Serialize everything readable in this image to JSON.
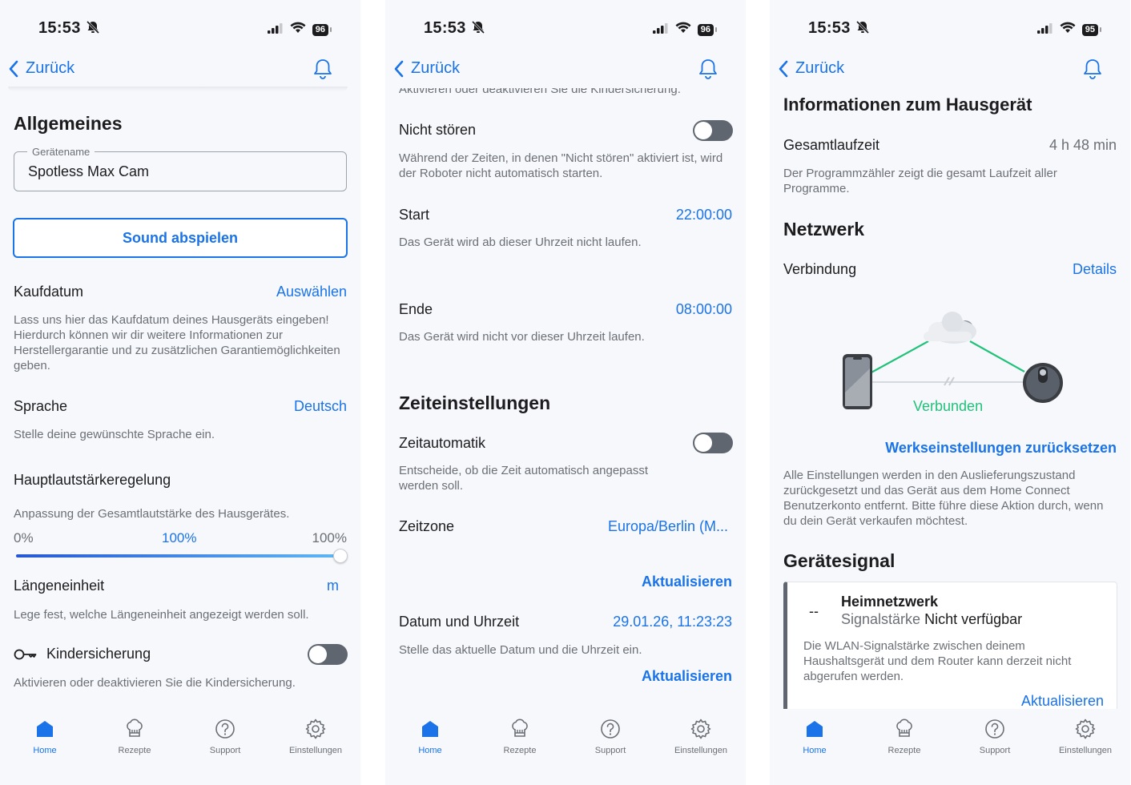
{
  "status": {
    "time": "15:53",
    "battery_1": "96",
    "battery_2": "96",
    "battery_3": "95"
  },
  "nav": {
    "back_label": "Zurück"
  },
  "screen1": {
    "section_title": "Allgemeines",
    "device_name_label": "Gerätename",
    "device_name_value": "Spotless Max Cam",
    "play_sound_button": "Sound abspielen",
    "purchase_date": {
      "label": "Kaufdatum",
      "value": "Auswählen",
      "desc": "Lass uns hier das Kaufdatum deines Hausgeräts eingeben! Hierdurch können wir dir weitere Informationen zur Herstellergarantie und zu zusätzlichen Garantiemöglichkeiten geben."
    },
    "language": {
      "label": "Sprache",
      "value": "Deutsch",
      "desc": "Stelle deine gewünschte Sprache ein."
    },
    "volume": {
      "label": "Hauptlautstärkeregelung",
      "desc": "Anpassung der Gesamtlautstärke des Hausgerätes.",
      "min_label": "0%",
      "current_label": "100%",
      "max_label": "100%",
      "level": 1.0
    },
    "length_unit": {
      "label": "Längeneinheit",
      "value": "m",
      "desc": "Lege fest, welche Längeneinheit angezeigt werden soll."
    },
    "child_lock": {
      "label": "Kindersicherung",
      "desc": "Aktivieren oder deaktivieren Sie die Kindersicherung.",
      "enabled": false
    }
  },
  "screen2": {
    "top_cut_text": "Aktivieren oder deaktivieren Sie die Kindersicherung.",
    "dnd": {
      "label": "Nicht stören",
      "desc": "Während der Zeiten, in denen \"Nicht stören\" aktiviert ist, wird der Roboter nicht automatisch starten.",
      "enabled": false
    },
    "start": {
      "label": "Start",
      "value": "22:00:00",
      "desc": "Das Gerät wird ab dieser Uhrzeit nicht laufen."
    },
    "end": {
      "label": "Ende",
      "value": "08:00:00",
      "desc": "Das Gerät wird nicht vor dieser Uhrzeit laufen."
    },
    "time_settings_title": "Zeiteinstellungen",
    "auto_time": {
      "label": "Zeitautomatik",
      "desc": "Entscheide, ob die Zeit automatisch angepasst werden soll.",
      "enabled": false
    },
    "timezone": {
      "label": "Zeitzone",
      "value": "Europa/Berlin (M..."
    },
    "update_1": "Aktualisieren",
    "datetime": {
      "label": "Datum und Uhrzeit",
      "value": "29.01.26, 11:23:23",
      "desc": "Stelle das aktuelle Datum und die Uhrzeit ein."
    },
    "update_2": "Aktualisieren"
  },
  "screen3": {
    "info_title": "Informationen zum Hausgerät",
    "runtime": {
      "label": "Gesamtlaufzeit",
      "value": "4 h 48 min",
      "desc": "Der Programmzähler zeigt die gesamt Laufzeit aller Programme."
    },
    "network_title": "Netzwerk",
    "connection": {
      "label": "Verbindung",
      "value": "Details"
    },
    "connected_label": "Verbunden",
    "factory_reset": {
      "link": "Werkseinstellungen zurücksetzen",
      "desc": "Alle Einstellungen werden in den Auslieferungszustand zurückgesetzt und das Gerät aus dem Home Connect Benutzerkonto entfernt. Bitte führe diese Aktion durch, wenn du dein Gerät verkaufen möchtest."
    },
    "signal_title": "Gerätesignal",
    "signal_card": {
      "dash": "--",
      "title": "Heimnetzwerk",
      "strength_label": "Signalstärke",
      "strength_value": "Nicht verfügbar",
      "desc": "Die WLAN-Signalstärke zwischen deinem Haushaltsgerät und dem Router kann derzeit nicht abgerufen werden.",
      "update": "Aktualisieren"
    }
  },
  "tabbar": {
    "home": "Home",
    "recipes": "Rezepte",
    "support": "Support",
    "settings": "Einstellungen"
  },
  "colors": {
    "accent": "#1a73e8",
    "connected": "#20c27a",
    "toggle_off": "#5f6670"
  },
  "icons": [
    "chevron-left-icon",
    "bell-icon",
    "bell-slash-icon",
    "signal-icon",
    "wifi-icon",
    "battery-icon",
    "home-icon",
    "chef-hat-icon",
    "help-circle-icon",
    "gear-icon",
    "key-icon",
    "cloud-icon",
    "phone-icon",
    "robot-vacuum-icon"
  ]
}
